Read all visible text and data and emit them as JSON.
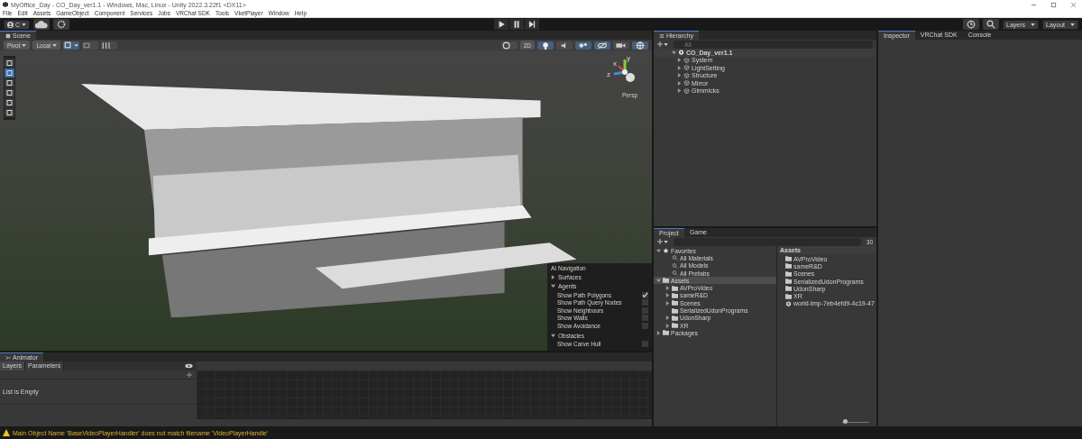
{
  "window": {
    "title": "MyOffice_Day - CO_Day_ver1.1 - Windows, Mac, Linux - Unity 2022.3.22f1 <DX11>"
  },
  "menu": [
    "File",
    "Edit",
    "Assets",
    "GameObject",
    "Component",
    "Services",
    "Jobs",
    "VRChat SDK",
    "Tools",
    "VketPlayer",
    "Window",
    "Help"
  ],
  "toolbar": {
    "account": "C",
    "layers": "Layers",
    "layout": "Layout"
  },
  "scene": {
    "tab": "Scene",
    "pivot": "Pivot",
    "local": "Local",
    "mode_2d": "2D",
    "persp": "Persp",
    "tools": [
      {
        "selected": false
      },
      {
        "selected": true
      },
      {
        "selected": false
      },
      {
        "selected": false
      },
      {
        "selected": false
      },
      {
        "selected": false
      }
    ],
    "gizmo_axes": [
      "y",
      "x",
      "z"
    ],
    "nav_overlay": {
      "title": "AI Navigation",
      "sections": [
        {
          "label": "Surfaces",
          "expanded": false
        },
        {
          "label": "Agents",
          "expanded": true,
          "items": [
            {
              "label": "Show Path Polygons",
              "checked": true
            },
            {
              "label": "Show Path Query Nodes",
              "checked": false
            },
            {
              "label": "Show Neighbours",
              "checked": false
            },
            {
              "label": "Show Walls",
              "checked": false
            },
            {
              "label": "Show Avoidance",
              "checked": false
            }
          ]
        },
        {
          "label": "Obstacles",
          "expanded": true,
          "items": [
            {
              "label": "Show Carve Hull",
              "checked": false
            }
          ]
        }
      ]
    }
  },
  "hierarchy": {
    "tab": "Hierarchy",
    "search_placeholder": "All",
    "scene": "CO_Day_ver1.1",
    "objects": [
      "System",
      "LightSetting",
      "Structure",
      "Mirror",
      "Gimmicks"
    ]
  },
  "project": {
    "tabs": [
      {
        "label": "Project",
        "selected": true
      },
      {
        "label": "Game",
        "selected": false
      }
    ],
    "hidden_count": "30",
    "tree": [
      {
        "label": "Favorites",
        "kind": "favorites",
        "expanded": true,
        "selected": false,
        "children": [
          {
            "label": "All Materials",
            "kind": "search",
            "selected": false
          },
          {
            "label": "All Models",
            "kind": "search",
            "selected": false
          },
          {
            "label": "All Prefabs",
            "kind": "search",
            "selected": false
          }
        ]
      },
      {
        "label": "Assets",
        "kind": "folder",
        "expanded": true,
        "selected": true,
        "children": [
          {
            "label": "AVProVideo",
            "kind": "folder",
            "expanded": false,
            "selected": false
          },
          {
            "label": "sameR&D",
            "kind": "folder",
            "expanded": false,
            "selected": false
          },
          {
            "label": "Scenes",
            "kind": "folder",
            "expanded": false,
            "selected": false
          },
          {
            "label": "SerializedUdonPrograms",
            "kind": "folder",
            "selected": false
          },
          {
            "label": "UdonSharp",
            "kind": "folder",
            "expanded": false,
            "selected": false
          },
          {
            "label": "XR",
            "kind": "folder",
            "expanded": false,
            "selected": false
          }
        ]
      },
      {
        "label": "Packages",
        "kind": "folder",
        "expanded": false,
        "selected": false
      }
    ],
    "breadcrumb": "Assets",
    "assets": [
      {
        "label": "AVProVideo",
        "kind": "folder"
      },
      {
        "label": "sameR&D",
        "kind": "folder"
      },
      {
        "label": "Scenes",
        "kind": "folder"
      },
      {
        "label": "SerializedUdonPrograms",
        "kind": "folder"
      },
      {
        "label": "UdonSharp",
        "kind": "folder"
      },
      {
        "label": "XR",
        "kind": "folder"
      },
      {
        "label": "world-tmp-7eb4efd9-4c19-47",
        "kind": "scene"
      }
    ],
    "zoom": {
      "level": 0.1
    }
  },
  "inspector": {
    "tabs": [
      {
        "label": "Inspector",
        "selected": true
      },
      {
        "label": "VRChat SDK",
        "selected": false
      },
      {
        "label": "Console",
        "selected": false
      }
    ]
  },
  "animator": {
    "tab": "Animator",
    "tabs": [
      {
        "label": "Layers",
        "selected": true
      },
      {
        "label": "Parameters",
        "selected": false
      }
    ],
    "empty": "List is Empty"
  },
  "status": {
    "message": "Main Object Name 'BaseVideoPlayerHandler' does not match filename 'VideoPlayerHandle'"
  }
}
